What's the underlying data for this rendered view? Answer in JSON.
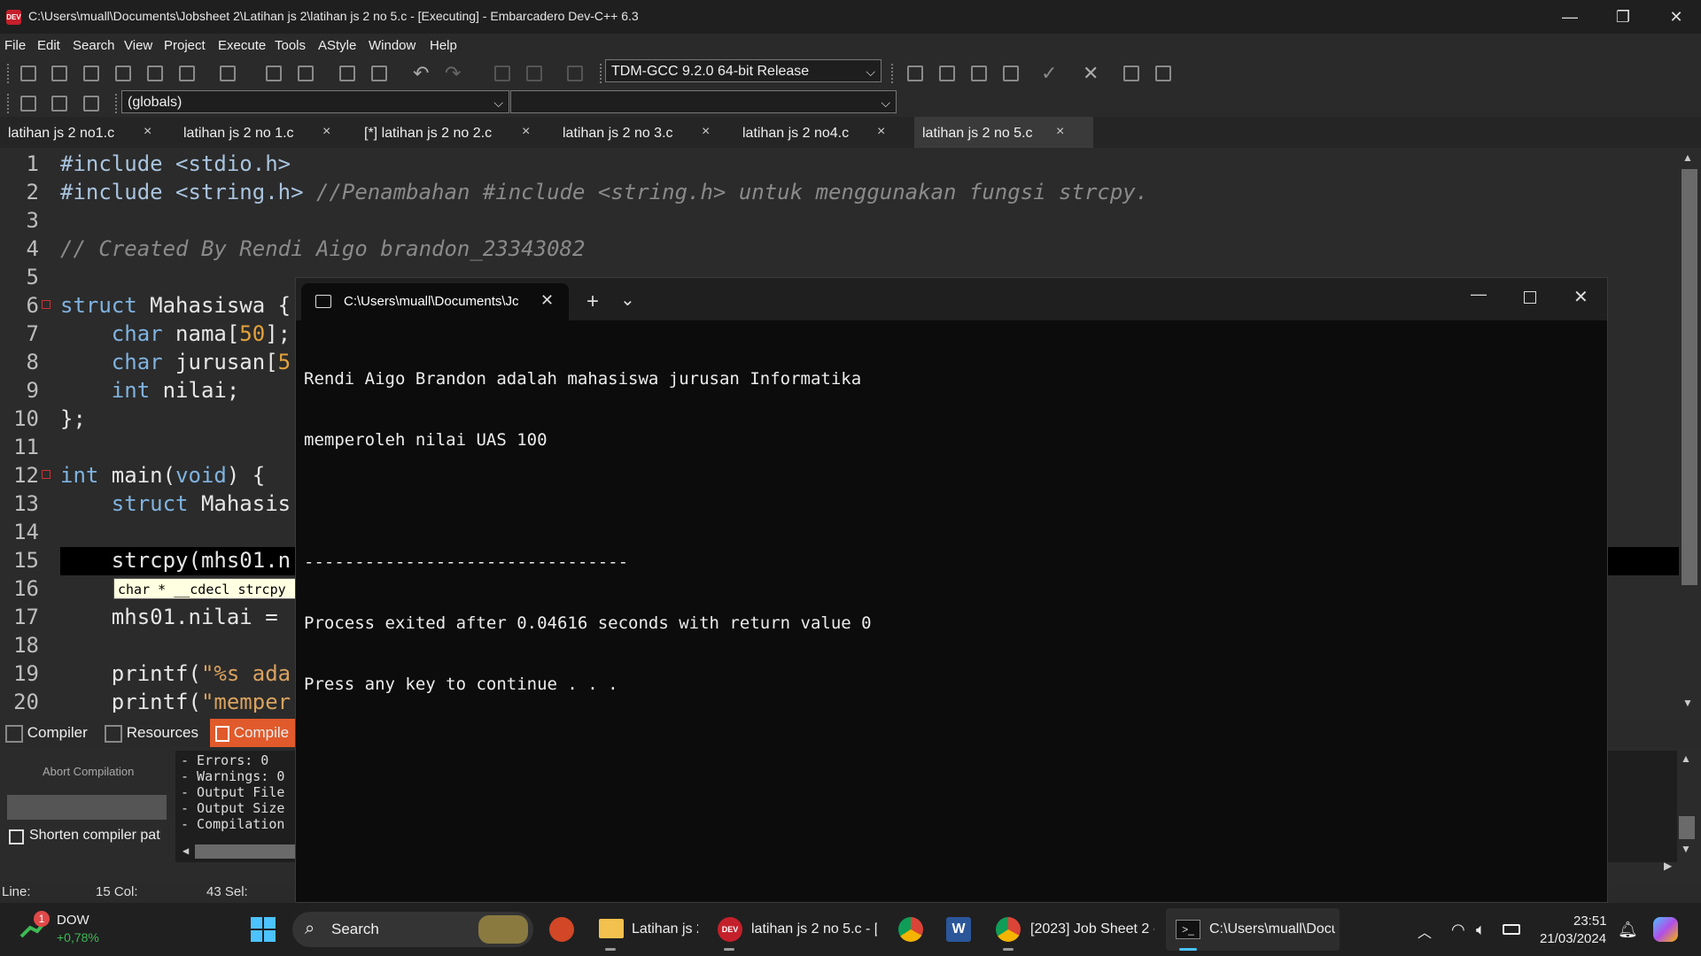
{
  "window": {
    "title": "C:\\Users\\muall\\Documents\\Jobsheet 2\\Latihan js 2\\latihan js 2 no 5.c - [Executing] - Embarcadero Dev-C++ 6.3",
    "icon_text": "DEV",
    "minimize": "—",
    "restore": "❐",
    "close": "✕"
  },
  "menu": [
    "File",
    "Edit",
    "Search",
    "View",
    "Project",
    "Execute",
    "Tools",
    "AStyle",
    "Window",
    "Help"
  ],
  "toolbar": {
    "compiler_select": "TDM-GCC 9.2.0 64-bit Release",
    "scope_select": "(globals)",
    "function_select": ""
  },
  "tabs": [
    {
      "label": "latihan js 2 no1.c",
      "close": "×"
    },
    {
      "label": "latihan js 2 no 1.c",
      "close": "×"
    },
    {
      "label": "[*] latihan js 2 no 2.c",
      "close": "×"
    },
    {
      "label": "latihan js 2 no 3.c",
      "close": "×"
    },
    {
      "label": "latihan js 2 no4.c",
      "close": "×"
    },
    {
      "label": "latihan js 2 no 5.c",
      "close": "×"
    }
  ],
  "editor": {
    "line_numbers": [
      "1",
      "2",
      "3",
      "4",
      "5",
      "6",
      "7",
      "8",
      "9",
      "10",
      "11",
      "12",
      "13",
      "14",
      "15",
      "16",
      "17",
      "18",
      "19",
      "20"
    ],
    "lines": {
      "l1a": "#include ",
      "l1b": "<stdio.h>",
      "l2a": "#include ",
      "l2b": "<string.h>",
      "l2c": " //Penambahan #include <string.h> untuk menggunakan fungsi strcpy.",
      "l4": "// Created By Rendi Aigo brandon_23343082",
      "l6a": "struct",
      "l6b": " Mahasiswa {",
      "l7a": "    char",
      "l7b": " nama[",
      "l7c": "50",
      "l7d": "];",
      "l8a": "    char",
      "l8b": " jurusan[",
      "l8c": "5",
      "l9a": "    int",
      "l9b": " nilai;",
      "l10": "};",
      "l12a": "int",
      "l12b": " main(",
      "l12c": "void",
      "l12d": ") {",
      "l13a": "    struct",
      "l13b": " Mahasis",
      "l15": "    strcpy(mhs01.n",
      "l17": "    mhs01.nilai = ",
      "l19a": "    printf(",
      "l19b": "\"%s ada",
      "l20a": "    printf(",
      "l20b": "\"memper"
    },
    "hint": "char * __cdecl strcpy"
  },
  "bottom_panel": {
    "tabs": [
      "Compiler",
      "Resources",
      "Compile"
    ],
    "abort_label": "Abort Compilation",
    "shorten_label": "Shorten compiler pat",
    "log": [
      "- Errors: 0",
      "- Warnings: 0",
      "- Output File",
      "- Output Size",
      "- Compilation"
    ]
  },
  "statusbar": {
    "line_label": "Line:",
    "line_value": "15 Col:",
    "col_value": "43 Sel:"
  },
  "terminal": {
    "tab_title": "C:\\Users\\muall\\Documents\\Jc",
    "new_tab": "+",
    "dropdown": "⌄",
    "output": [
      "Rendi Aigo Brandon adalah mahasiswa jurusan Informatika",
      "memperoleh nilai UAS 100",
      "",
      "--------------------------------",
      "Process exited after 0.04616 seconds with return value 0",
      "Press any key to continue . . ."
    ]
  },
  "taskbar": {
    "stock_name": "DOW",
    "stock_change": "+0,78%",
    "stock_badge": "1",
    "search_label": "Search",
    "apps": [
      {
        "label": "Latihan js 2"
      },
      {
        "label": "latihan js 2 no 5.c - [E"
      },
      {
        "label": "[2023] Job Sheet 2 -"
      },
      {
        "label": "C:\\Users\\muall\\Docu"
      }
    ],
    "time": "23:51",
    "date": "21/03/2024"
  },
  "colors": {
    "accent_tab": "#e05a2b",
    "terminal_bg": "#0c0c0c"
  }
}
